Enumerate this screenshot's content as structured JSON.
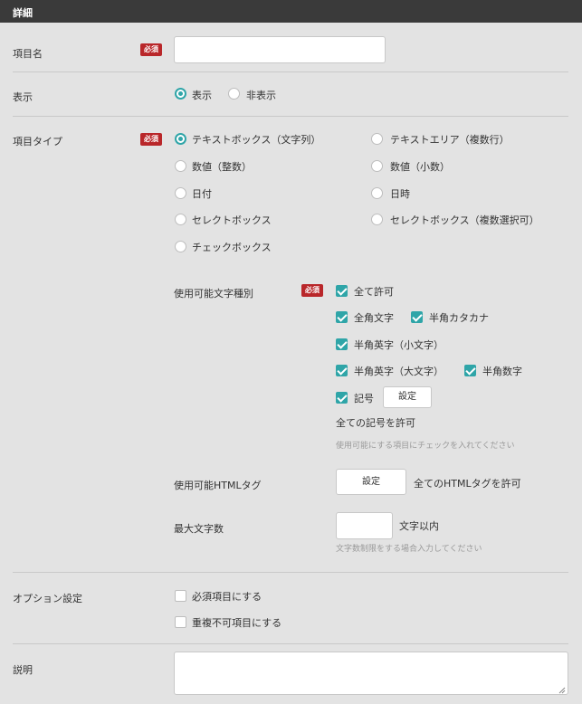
{
  "header": {
    "title": "詳細"
  },
  "required_badge": "必須",
  "item_name": {
    "label": "項目名",
    "value": "",
    "placeholder": ""
  },
  "display": {
    "label": "表示",
    "options": [
      {
        "label": "表示",
        "selected": true
      },
      {
        "label": "非表示",
        "selected": false
      }
    ]
  },
  "item_type": {
    "label": "項目タイプ",
    "options": [
      {
        "label": "テキストボックス（文字列）",
        "selected": true
      },
      {
        "label": "テキストエリア（複数行）",
        "selected": false
      },
      {
        "label": "数値（整数）",
        "selected": false
      },
      {
        "label": "数値（小数）",
        "selected": false
      },
      {
        "label": "日付",
        "selected": false
      },
      {
        "label": "日時",
        "selected": false
      },
      {
        "label": "セレクトボックス",
        "selected": false
      },
      {
        "label": "セレクトボックス（複数選択可）",
        "selected": false
      },
      {
        "label": "チェックボックス",
        "selected": false
      }
    ]
  },
  "char_types": {
    "label": "使用可能文字種別",
    "options": [
      {
        "label": "全て許可",
        "checked": true
      },
      {
        "label": "全角文字",
        "checked": true
      },
      {
        "label": "半角カタカナ",
        "checked": true
      },
      {
        "label": "半角英字（小文字）",
        "checked": true
      },
      {
        "label": "半角英字（大文字）",
        "checked": true
      },
      {
        "label": "半角数字",
        "checked": true
      },
      {
        "label": "記号",
        "checked": true
      }
    ],
    "settings_button": "設定",
    "symbols_note": "全ての記号を許可",
    "hint": "使用可能にする項目にチェックを入れてください"
  },
  "html_tags": {
    "label": "使用可能HTMLタグ",
    "settings_button": "設定",
    "note": "全てのHTMLタグを許可"
  },
  "max_chars": {
    "label": "最大文字数",
    "value": "",
    "suffix": "文字以内",
    "hint": "文字数制限をする場合入力してください"
  },
  "option_settings": {
    "label": "オプション設定",
    "options": [
      {
        "label": "必須項目にする",
        "checked": false
      },
      {
        "label": "重複不可項目にする",
        "checked": false
      }
    ]
  },
  "description": {
    "label": "説明",
    "value": ""
  },
  "colors": {
    "accent": "#2fa5a8",
    "required": "#b9272a",
    "header_bg": "#3a3a3a",
    "background": "#e3e3e3"
  }
}
